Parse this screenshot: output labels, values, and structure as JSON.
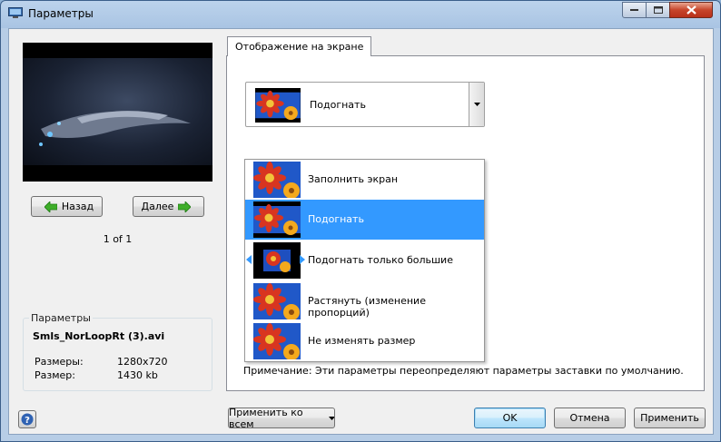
{
  "window": {
    "title": "Параметры",
    "icon": "monitor-icon"
  },
  "preview": {
    "back_label": "Назад",
    "next_label": "Далее",
    "pager": "1 of 1"
  },
  "properties": {
    "legend": "Параметры",
    "filename": "Smls_NorLoopRt (3).avi",
    "dimensions_label": "Размеры:",
    "dimensions_value": "1280x720",
    "size_label": "Размер:",
    "size_value": "1430 kb"
  },
  "tab": {
    "label": "Отображение на экране"
  },
  "combo": {
    "selected": "Подогнать"
  },
  "options": [
    {
      "label": "Заполнить экран",
      "mode": "fill"
    },
    {
      "label": "Подогнать",
      "mode": "fit",
      "selected": true
    },
    {
      "label": "Подогнать только большие",
      "mode": "fit-large"
    },
    {
      "label": "Растянуть (изменение пропорций)",
      "mode": "stretch"
    },
    {
      "label": "Не изменять размер",
      "mode": "none"
    }
  ],
  "note": "Примечание: Эти параметры переопределяют параметры заставки по умолчанию.",
  "buttons": {
    "apply_all": "Применить ко всем",
    "ok": "OK",
    "cancel": "Отмена",
    "apply": "Применить"
  },
  "colors": {
    "selection": "#3399ff",
    "nav_arrow": "#3fae2a"
  }
}
